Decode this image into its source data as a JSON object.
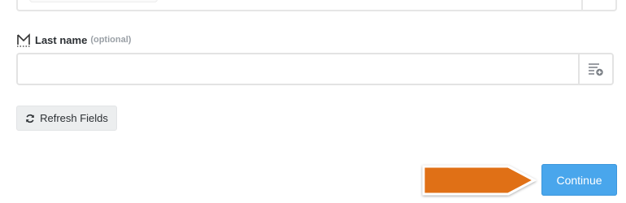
{
  "form": {
    "last_name": {
      "label": "Last name",
      "optional_tag": "(optional)",
      "value": "",
      "placeholder": ""
    },
    "refresh_label": "Refresh Fields",
    "continue_label": "Continue"
  },
  "colors": {
    "primary": "#49a6ec",
    "arrow": "#e06f14",
    "border": "#e3e3e3"
  },
  "icons": {
    "label_icon": "gmail-icon",
    "insert_data": "insert-data-icon",
    "refresh": "refresh-icon"
  }
}
